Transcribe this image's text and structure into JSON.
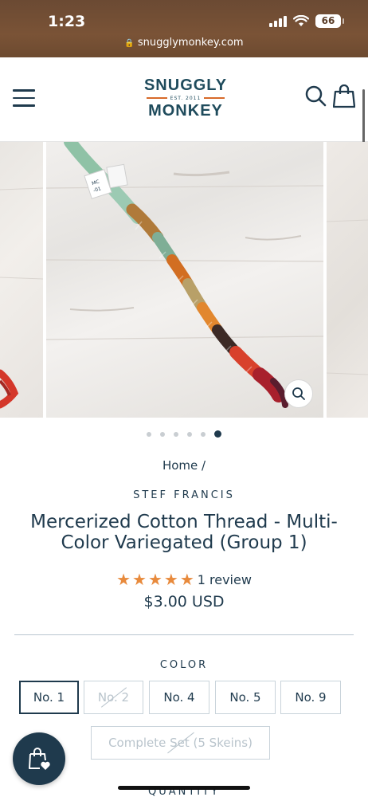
{
  "status_bar": {
    "time": "1:23",
    "battery": "66"
  },
  "browser": {
    "url": "snugglymonkey.com"
  },
  "header": {
    "logo_top": "SNUGGLY",
    "logo_est": "EST. 2011",
    "logo_bottom": "MONKEY"
  },
  "gallery": {
    "tag_text": "MC\n-01",
    "dot_count": 6,
    "active_dot": 5
  },
  "product": {
    "breadcrumb": "Home /",
    "vendor": "STEF FRANCIS",
    "title": "Mercerized Cotton Thread - Multi-Color Variegated (Group 1)",
    "stars": 5,
    "review_text": "1 review",
    "price": "$3.00 USD"
  },
  "options": {
    "color_label": "COLOR",
    "swatches": [
      {
        "label": "No. 1",
        "state": "selected"
      },
      {
        "label": "No. 2",
        "state": "unavailable"
      },
      {
        "label": "No. 4",
        "state": "available"
      },
      {
        "label": "No. 5",
        "state": "available"
      },
      {
        "label": "No. 9",
        "state": "available"
      },
      {
        "label": "Complete Set (5 Skeins)",
        "state": "unavailable"
      }
    ],
    "quantity_label": "QUANTITY"
  },
  "colors": {
    "brand_navy": "#1f3a4d",
    "star_orange": "#e88a3c",
    "logo_accent": "#d86a2a"
  }
}
